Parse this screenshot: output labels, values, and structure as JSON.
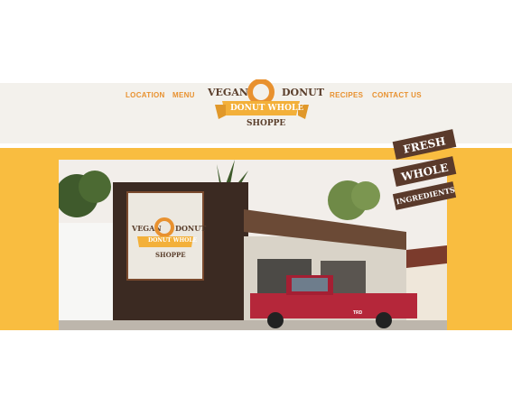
{
  "nav": {
    "location": "LOCATION",
    "menu": "MENU",
    "recipes": "RECIPES",
    "contact": "CONTACT US"
  },
  "logo": {
    "word_left": "VEGAN",
    "word_right": "DONUT",
    "ribbon": "DONUT WHOLE",
    "bottom": "SHOPPE"
  },
  "badge": {
    "line1": "FRESH",
    "line2": "WHOLE",
    "line3": "INGREDIENTS"
  },
  "truck_text": "TRD",
  "colors": {
    "accent_orange": "#e8912f",
    "banner_yellow": "#f9bd40",
    "brown": "#5a3e2b",
    "header_bg": "#f3f1ec"
  }
}
